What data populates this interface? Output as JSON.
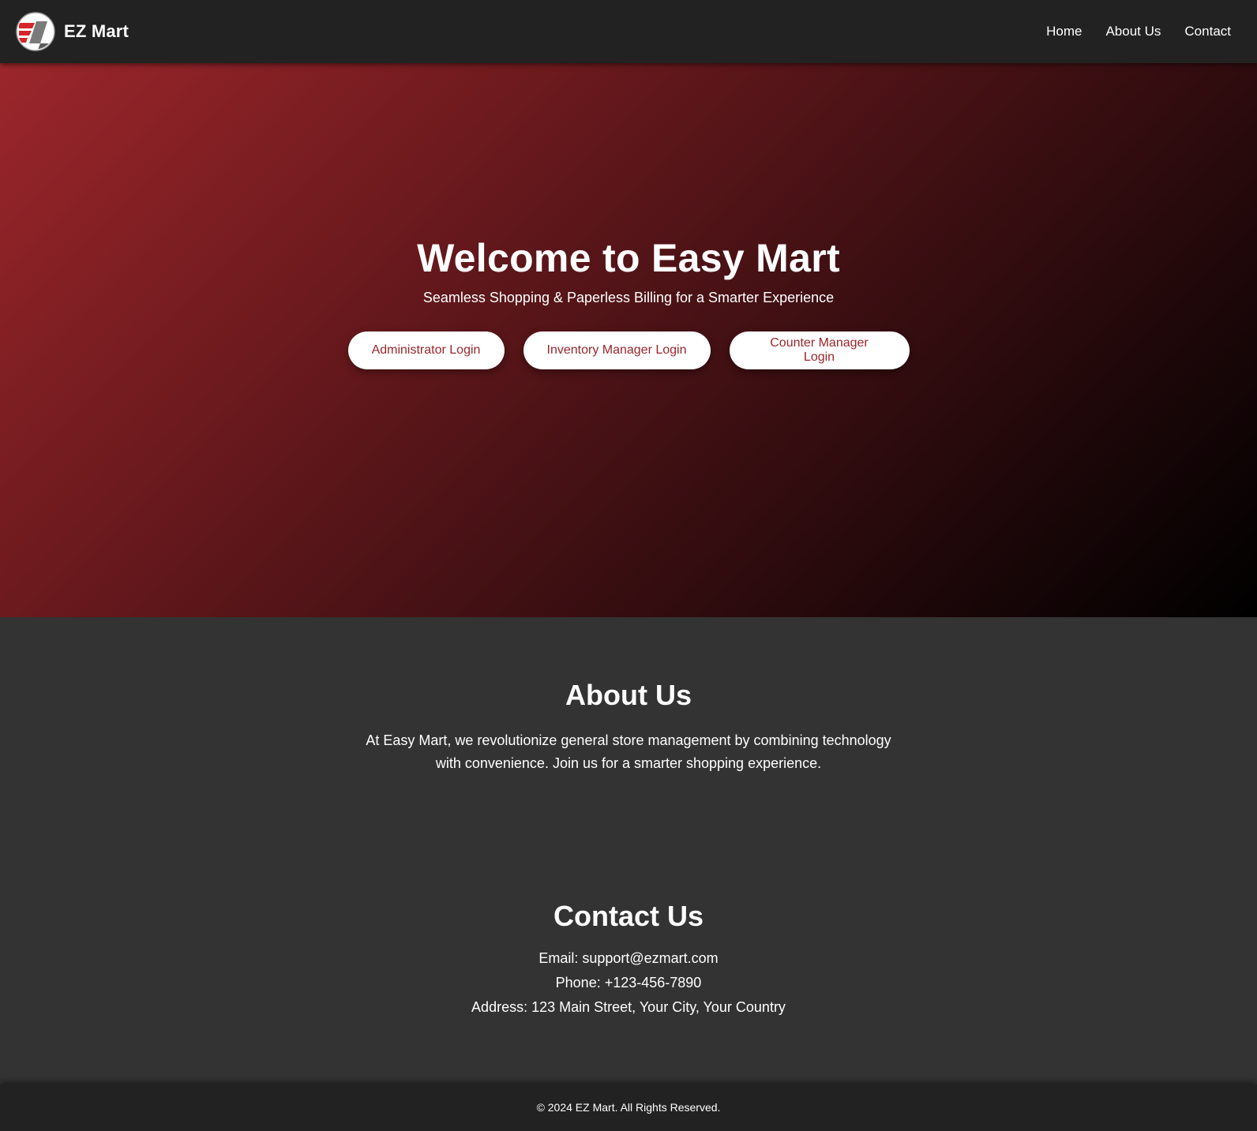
{
  "header": {
    "brand_name": "EZ Mart",
    "logo": "ez-mart-logo",
    "nav": [
      {
        "label": "Home"
      },
      {
        "label": "About Us"
      },
      {
        "label": "Contact"
      }
    ]
  },
  "hero": {
    "title": "Welcome to Easy Mart",
    "subtitle": "Seamless Shopping & Paperless Billing for a Smarter Experience",
    "buttons": {
      "admin": "Administrator Login",
      "inventory": "Inventory Manager Login",
      "counter": "Counter Manager Login"
    }
  },
  "about": {
    "title": "About Us",
    "text": "At Easy Mart, we revolutionize general store management by combining technology with convenience. Join us for a smarter shopping experience."
  },
  "contact": {
    "title": "Contact Us",
    "email": "Email: support@ezmart.com",
    "phone": "Phone: +123-456-7890",
    "address": "Address: 123 Main Street, Your City, Your Country"
  },
  "footer": {
    "text": "© 2024 EZ Mart. All Rights Reserved."
  },
  "colors": {
    "header_bg": "#222222",
    "page_bg": "#333333",
    "accent": "#9b262b",
    "text": "#ffffff"
  }
}
